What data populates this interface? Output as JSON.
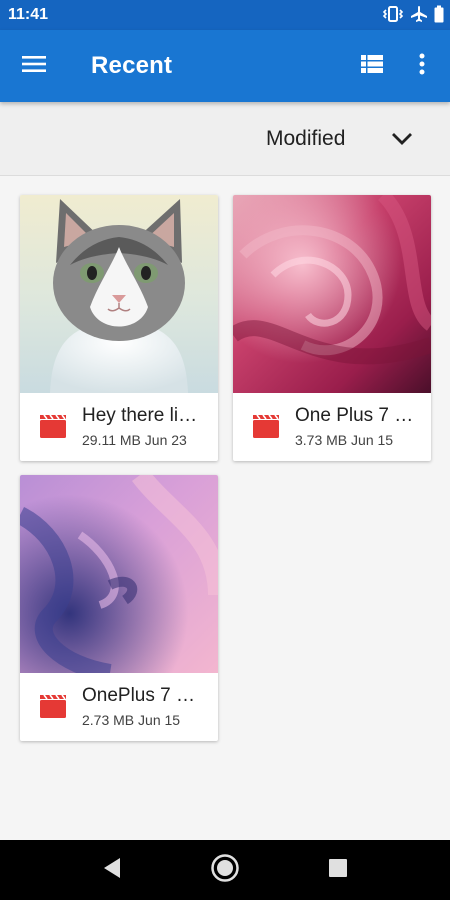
{
  "status_bar": {
    "time": "11:41",
    "icons": [
      "vibrate-icon",
      "airplane-mode-icon",
      "battery-icon"
    ]
  },
  "app_bar": {
    "title": "Recent",
    "icons": [
      "menu-icon",
      "list-view-icon",
      "more-vert-icon"
    ]
  },
  "sort": {
    "label": "Modified",
    "icon": "chevron-down-icon"
  },
  "files": [
    {
      "name": "Hey there li…",
      "size": "29.11 MB",
      "date": "Jun 23",
      "icon": "video-file-icon",
      "thumbnail": "cat photo"
    },
    {
      "name": "One Plus 7 …",
      "size": "3.73 MB",
      "date": "Jun 15",
      "icon": "video-file-icon",
      "thumbnail": "pink swirl wallpaper"
    },
    {
      "name": "OnePlus 7 …",
      "size": "2.73 MB",
      "date": "Jun 15",
      "icon": "video-file-icon",
      "thumbnail": "purple swirl wallpaper"
    }
  ],
  "nav_bar": {
    "icons": [
      "back-icon",
      "home-icon",
      "recents-icon"
    ]
  },
  "colors": {
    "status_bar": "#1565c0",
    "app_bar": "#1976d2",
    "file_icon": "#e53935"
  }
}
